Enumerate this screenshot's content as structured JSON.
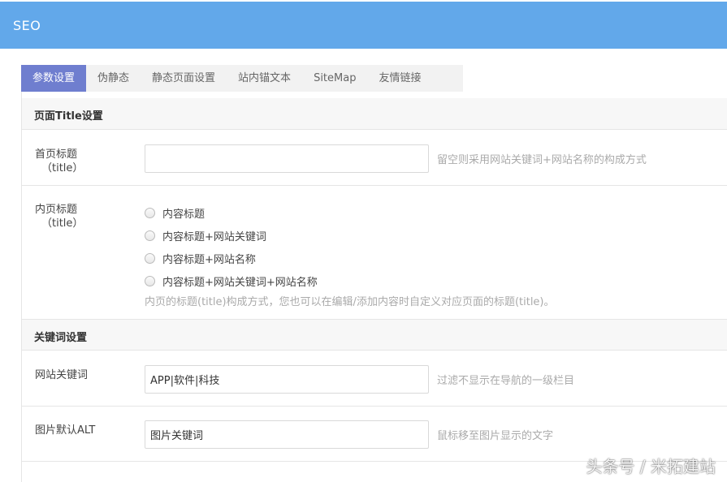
{
  "header": {
    "title": "SEO"
  },
  "tabs": [
    {
      "label": "参数设置"
    },
    {
      "label": "伪静态"
    },
    {
      "label": "静态页面设置"
    },
    {
      "label": "站内锚文本"
    },
    {
      "label": "SiteMap"
    },
    {
      "label": "友情链接"
    }
  ],
  "section_title": {
    "heading": "页面Title设置",
    "home_title": {
      "label": "首页标题",
      "label_sub": "（title）",
      "value": "",
      "hint": "留空则采用网站关键词+网站名称的构成方式"
    },
    "inner_title": {
      "label": "内页标题",
      "label_sub": "（title）",
      "options": [
        "内容标题",
        "内容标题+网站关键词",
        "内容标题+网站名称",
        "内容标题+网站关键词+网站名称"
      ],
      "description": "内页的标题(title)构成方式，您也可以在编辑/添加内容时自定义对应页面的标题(title)。"
    }
  },
  "section_keywords": {
    "heading": "关键词设置",
    "site_keywords": {
      "label": "网站关键词",
      "value": "APP|软件|科技",
      "hint": "过滤不显示在导航的一级栏目"
    },
    "image_alt": {
      "label": "图片默认ALT",
      "value": "图片关键词",
      "hint": "鼠标移至图片显示的文字"
    }
  },
  "watermark": "头条号 / 米拓建站"
}
